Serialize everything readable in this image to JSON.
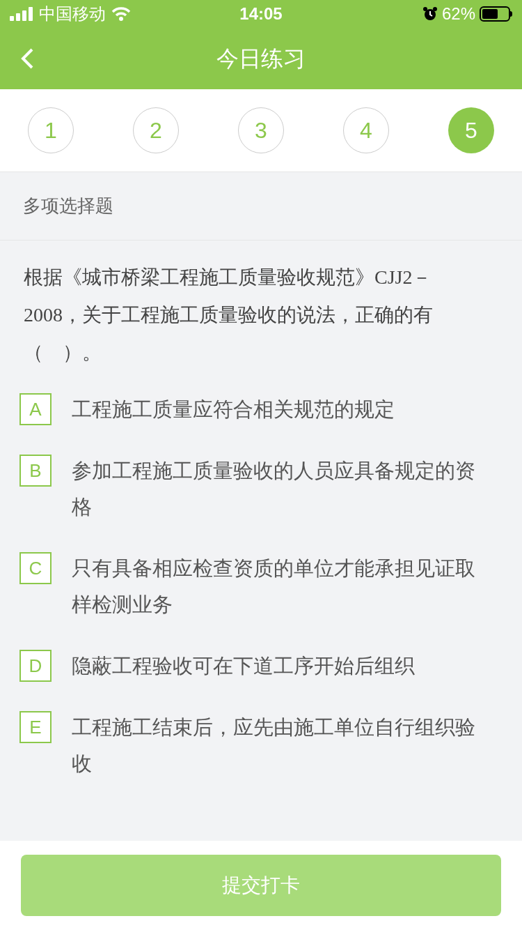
{
  "status_bar": {
    "carrier": "中国移动",
    "time": "14:05",
    "battery": "62%"
  },
  "header": {
    "title": "今日练习"
  },
  "question_tabs": [
    {
      "label": "1",
      "selected": false
    },
    {
      "label": "2",
      "selected": false
    },
    {
      "label": "3",
      "selected": false
    },
    {
      "label": "4",
      "selected": false
    },
    {
      "label": "5",
      "selected": true
    }
  ],
  "section_title": "多项选择题",
  "question": "根据《城市桥梁工程施工质量验收规范》CJJ2－2008，关于工程施工质量验收的说法，正确的有（　）。",
  "options": [
    {
      "letter": "A",
      "text": "工程施工质量应符合相关规范的规定",
      "selected": false
    },
    {
      "letter": "B",
      "text": "参加工程施工质量验收的人员应具备规定的资格",
      "selected": false
    },
    {
      "letter": "C",
      "text": "只有具备相应检查资质的单位才能承担见证取样检测业务",
      "selected": false
    },
    {
      "letter": "D",
      "text": "隐蔽工程验收可在下道工序开始后组织",
      "selected": false
    },
    {
      "letter": "E",
      "text": "工程施工结束后，应先由施工单位自行组织验收",
      "selected": false
    }
  ],
  "submit": {
    "label": "提交打卡",
    "disabled": true
  }
}
